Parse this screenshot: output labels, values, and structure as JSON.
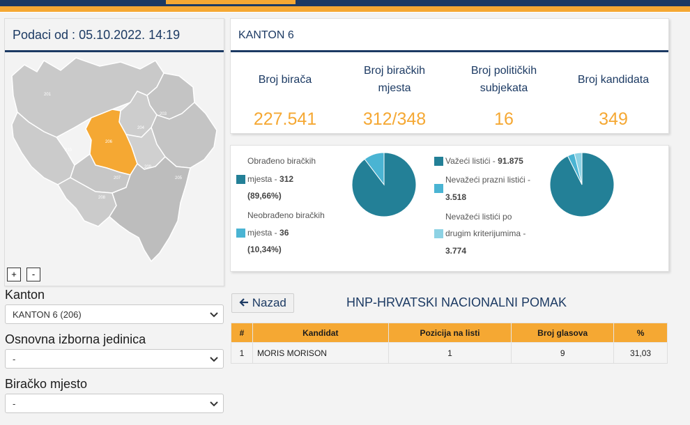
{
  "header": {
    "data_label": "Podaci od : 05.10.2022. 14:19"
  },
  "map": {
    "regions": {
      "201": "201",
      "203": "203",
      "204": "204",
      "205": "205",
      "206": "206",
      "207": "207",
      "208": "208",
      "209": "209",
      "210": "210"
    },
    "highlight_color": "#f5a833",
    "base_color": "#c4c4c4",
    "zoom_in": "+",
    "zoom_out": "-"
  },
  "filters": {
    "kanton_label": "Kanton",
    "kanton_value": "KANTON 6 (206)",
    "oij_label": "Osnovna izborna jedinica",
    "oij_value": "-",
    "bm_label": "Biračko mjesto",
    "bm_value": "-"
  },
  "summary": {
    "title": "KANTON 6",
    "stats": [
      {
        "label": "Broj birača",
        "value": "227.541"
      },
      {
        "label": "Broj biračkih mjesta",
        "value": "312/348"
      },
      {
        "label": "Broj političkih subjekata",
        "value": "16"
      },
      {
        "label": "Broj kandidata",
        "value": "349"
      }
    ]
  },
  "charts": {
    "colors": {
      "primary": "#238097",
      "secondary": "#4ab4d3",
      "tertiary": "#8dd2e4"
    },
    "legend1": {
      "l1": "Obrađeno biračkih",
      "l2": "mjesta - ",
      "l2b": "312",
      "l3b": "(89,66%)",
      "l4": "Neobrađeno biračkih",
      "l5": "mjesta - ",
      "l5b": "36",
      "l6b": "(10,34%)"
    },
    "legend2": {
      "l1": "Važeći listići - ",
      "l1b": "91.875",
      "l2": "Nevažeći prazni listići -",
      "l3b": "3.518",
      "l4": "Nevažeći listići po",
      "l5": "drugim kriterijumima -",
      "l6b": "3.774"
    }
  },
  "chart_data": [
    {
      "type": "pie",
      "categories": [
        "Obrađeno biračkih mjesta",
        "Neobrađeno biračkih mjesta"
      ],
      "values": [
        312,
        36
      ],
      "title": ""
    },
    {
      "type": "pie",
      "categories": [
        "Važeći listići",
        "Nevažeći prazni listići",
        "Nevažeći listići po drugim kriterijumima"
      ],
      "values": [
        91875,
        3518,
        3774
      ],
      "title": ""
    }
  ],
  "results": {
    "back_label": "Nazad",
    "party_name": "HNP-HRVATSKI NACIONALNI POMAK",
    "headers": [
      "#",
      "Kandidat",
      "Pozicija na listi",
      "Broj glasova",
      "%"
    ],
    "rows": [
      [
        "1",
        "MORIS MORISON",
        "1",
        "9",
        "31,03"
      ]
    ]
  }
}
